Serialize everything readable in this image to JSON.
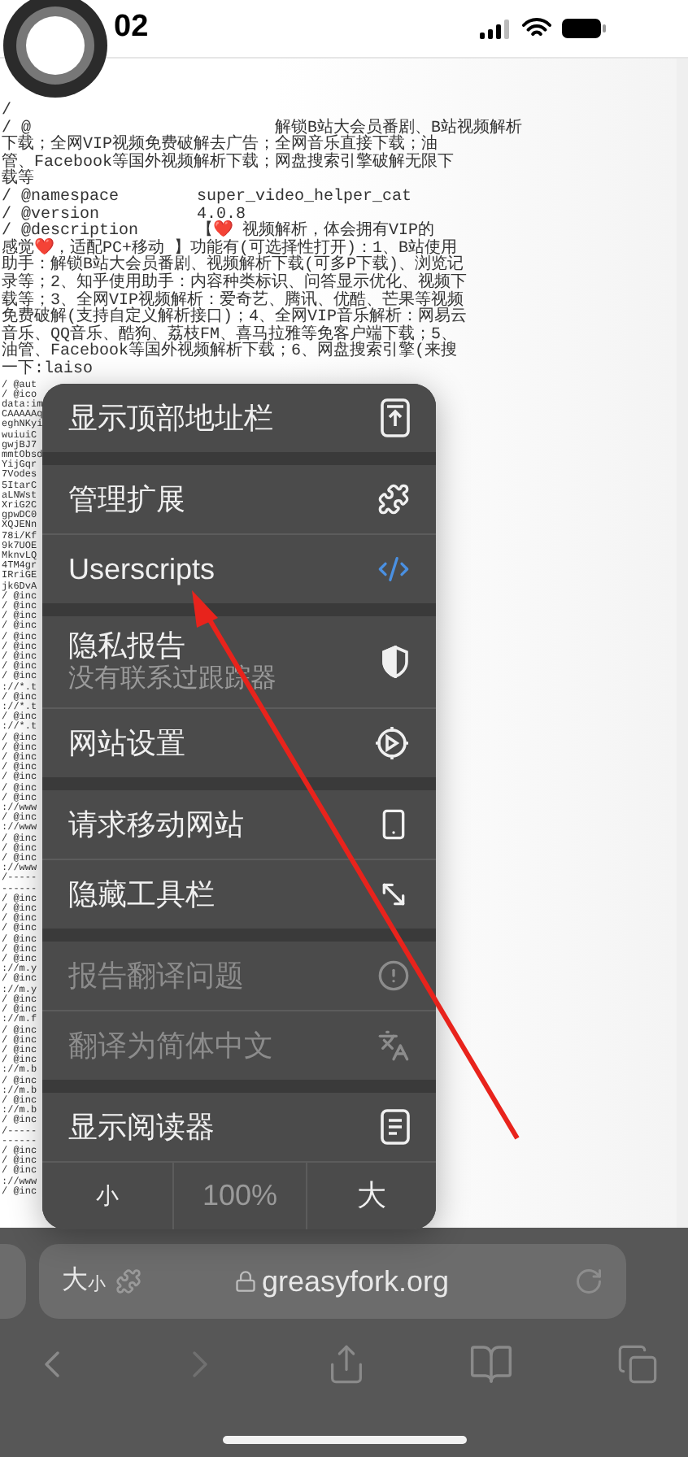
{
  "status_bar": {
    "time": "02"
  },
  "page": {
    "code_lines": [
      "/",
      "/ @                         解锁B站大会员番剧、B站视频解析",
      "下载；全网VIP视频免费破解去广告；全网音乐直接下载；油",
      "管、Facebook等国外视频解析下载；网盘搜索引擎破解无限下",
      "载等",
      "/ @namespace        super_video_helper_cat",
      "/ @version          4.0.8",
      "/ @description      【❤️ 视频解析，体会拥有VIP的",
      "感觉❤️，适配PC+移动 】功能有(可选择性打开)：1、B站使用",
      "助手：解锁B站大会员番剧、视频解析下载(可多P下载)、浏览记",
      "录等；2、知乎使用助手：内容种类标识、问答显示优化、视频下",
      "载等；3、全网VIP视频解析：爱奇艺、腾讯、优酷、芒果等视频",
      "免费破解(支持自定义解析接口)；4、全网VIP音乐解析：网易云",
      "音乐、QQ音乐、酷狗、荔枝FM、喜马拉雅等免客户端下载；5、",
      "油管、Facebook等国外视频解析下载；6、网盘搜索引擎(来搜",
      "一下:laiso"
    ],
    "side_lines": [
      "/ @aut",
      "/ @ico",
      "data:im",
      "CAAAAAq",
      "eghNKyi",
      "wuiuiC",
      "gwjBJ7",
      "mmtObsd",
      "YijGqr",
      "7Vodes",
      "5ItarC",
      "aLNWst",
      "XriG2C",
      "gpwDC0",
      "XQJENn",
      "78i/Kf",
      "9k7UOE",
      "MknvLQ",
      "4TM4gr",
      "IRriGE",
      "jk6DvA",
      "/ @inc",
      "/ @inc",
      "/ @inc",
      "/ @inc",
      "/ @inc",
      "/ @inc",
      "/ @inc",
      "/ @inc",
      "/ @inc",
      "://*.t",
      "/ @inc",
      "://*.t",
      "/ @inc",
      "://*.t",
      "/ @inc",
      "/ @inc",
      "/ @inc",
      "/ @inc",
      "/ @inc",
      "/ @inc",
      "/ @inc",
      "://www",
      "/ @inc",
      "://www",
      "/ @inc",
      "/ @inc",
      "/ @inc",
      "://www",
      "/-----",
      "------",
      "/ @inc",
      "/ @inc",
      "/ @inc",
      "/ @inc",
      "/ @inc",
      "/ @inc",
      "/ @inc",
      "://m.y",
      "/ @inc",
      "://m.y",
      "/ @inc",
      "/ @inc",
      "://m.f",
      "/ @inc",
      "/ @inc",
      "/ @inc",
      "/ @inc",
      "://m.b",
      "/ @inc",
      "://m.b",
      "/ @inc",
      "://m.b",
      "/ @inc",
      "/-----",
      "------",
      "/ @inc",
      "/ @inc",
      "/ @inc",
      "://www",
      "/ @inc"
    ]
  },
  "menu": {
    "groups": [
      [
        {
          "label": "显示顶部地址栏",
          "disabled": false
        }
      ],
      [
        {
          "label": "管理扩展",
          "disabled": false
        },
        {
          "label": "Userscripts",
          "disabled": false
        }
      ],
      [
        {
          "label": "隐私报告",
          "subtitle": "没有联系过跟踪器",
          "disabled": false
        },
        {
          "label": "网站设置",
          "disabled": false
        }
      ],
      [
        {
          "label": "请求移动网站",
          "disabled": false
        },
        {
          "label": "隐藏工具栏",
          "disabled": false
        }
      ],
      [
        {
          "label": "报告翻译问题",
          "disabled": true
        },
        {
          "label": "翻译为简体中文",
          "disabled": true
        }
      ],
      [
        {
          "label": "显示阅读器",
          "disabled": false
        }
      ]
    ],
    "zoom": {
      "smaller": "小",
      "level": "100%",
      "larger": "大"
    }
  },
  "address_bar": {
    "text_size_large": "大",
    "text_size_small": "小",
    "url": "greasyfork.org"
  }
}
